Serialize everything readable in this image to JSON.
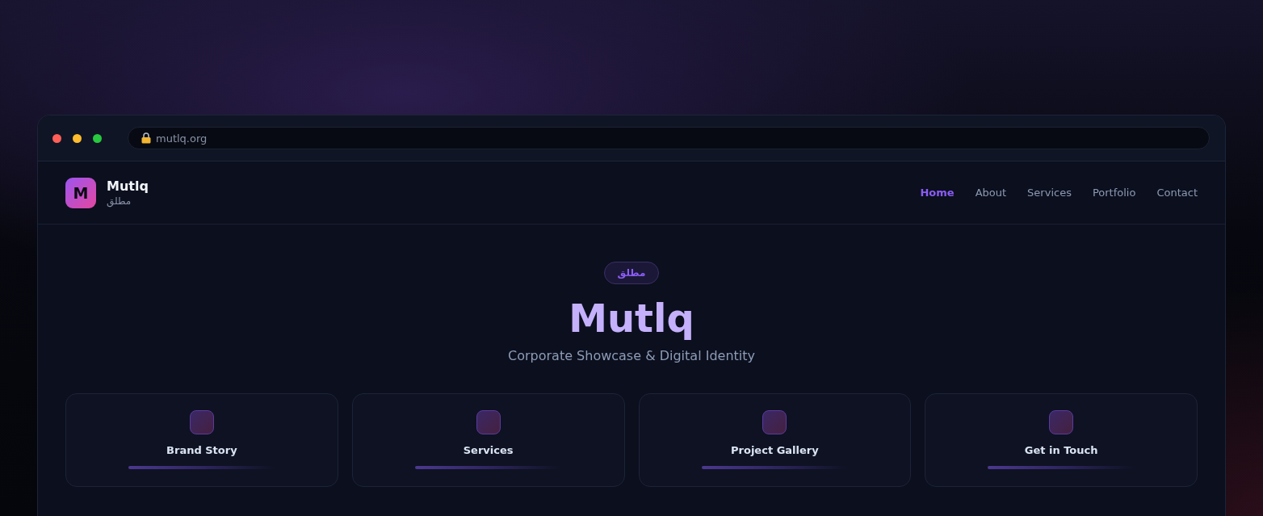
{
  "browser": {
    "url": "mutlq.org",
    "secure": true
  },
  "header": {
    "logo_letter": "M",
    "brand_name": "Mutlq",
    "brand_subtitle": "مطلق"
  },
  "nav": [
    {
      "label": "Home",
      "selected": true
    },
    {
      "label": "About",
      "selected": false
    },
    {
      "label": "Services",
      "selected": false
    },
    {
      "label": "Portfolio",
      "selected": false
    },
    {
      "label": "Contact",
      "selected": false
    }
  ],
  "hero": {
    "badge": "مطلق",
    "title": "Mutlq",
    "subtitle": "Corporate Showcase & Digital Identity"
  },
  "cards": [
    {
      "title": "Brand Story"
    },
    {
      "title": "Services"
    },
    {
      "title": "Project Gallery"
    },
    {
      "title": "Get in Touch"
    }
  ]
}
